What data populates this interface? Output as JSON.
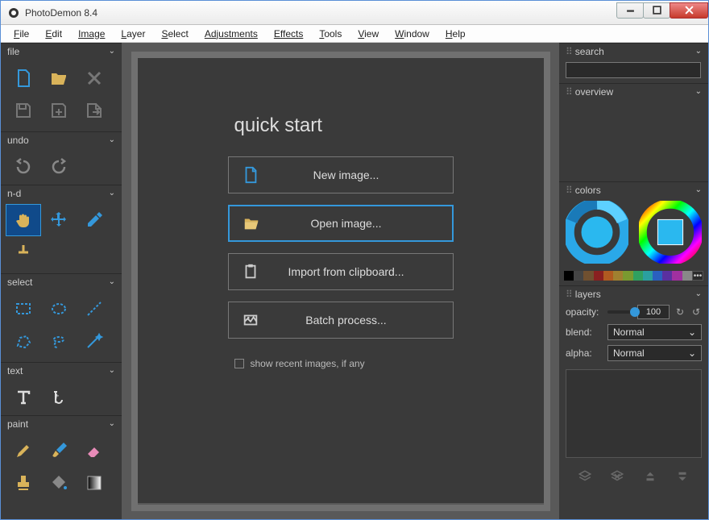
{
  "app": {
    "title": "PhotoDemon 8.4"
  },
  "menubar": [
    "File",
    "Edit",
    "Image",
    "Layer",
    "Select",
    "Adjustments",
    "Effects",
    "Tools",
    "View",
    "Window",
    "Help"
  ],
  "left_sections": {
    "file": "file",
    "undo": "undo",
    "nd": "n-d",
    "select": "select",
    "text": "text",
    "paint": "paint"
  },
  "quickstart": {
    "title": "quick start",
    "new": "New image...",
    "open": "Open image...",
    "clipboard": "Import from clipboard...",
    "batch": "Batch process...",
    "recent": "show recent images, if any"
  },
  "right": {
    "search": "search",
    "overview": "overview",
    "colors": "colors",
    "layers": "layers",
    "opacity_label": "opacity:",
    "opacity_value": "100",
    "blend_label": "blend:",
    "blend_value": "Normal",
    "alpha_label": "alpha:",
    "alpha_value": "Normal"
  },
  "swatches": [
    "#000",
    "#444",
    "#705030",
    "#8a2020",
    "#b05a20",
    "#a08030",
    "#7a9a30",
    "#30a060",
    "#2aa0a0",
    "#2a60c0",
    "#5a30a0",
    "#a030a0",
    "#888",
    "#fff"
  ]
}
